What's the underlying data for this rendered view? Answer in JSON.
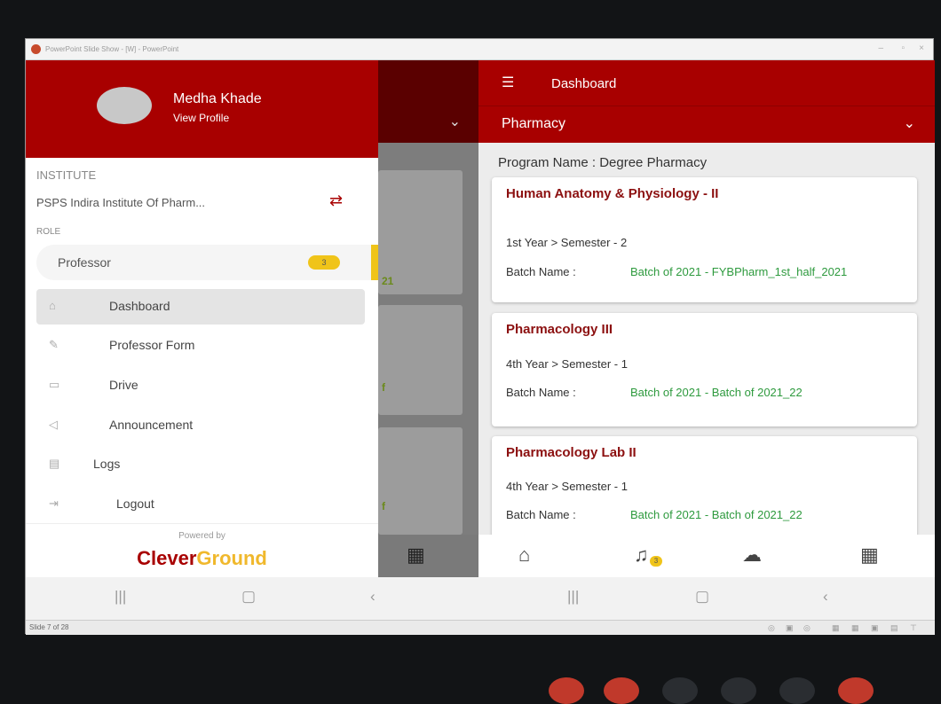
{
  "window": {
    "title": "PowerPoint Slide Show - [W] - PowerPoint",
    "controls": [
      "–",
      "▫",
      "×"
    ]
  },
  "drawer": {
    "user_name": "Medha Khade",
    "view_profile": "View Profile",
    "institute_heading": "INSTITUTE",
    "institute_name": "PSPS Indira Institute Of Pharm...",
    "role_heading": "ROLE",
    "role": "Professor",
    "role_badge": "3",
    "items": [
      {
        "label": "Dashboard",
        "icon": "home-icon"
      },
      {
        "label": "Professor Form",
        "icon": "form-icon"
      },
      {
        "label": "Drive",
        "icon": "folder-icon"
      },
      {
        "label": "Announcement",
        "icon": "megaphone-icon"
      },
      {
        "label": "Logs",
        "icon": "logs-icon"
      },
      {
        "label": "Logout",
        "icon": "logout-icon"
      }
    ],
    "powered_by": "Powered by",
    "brand_part1": "Clever",
    "brand_part2": "Ground"
  },
  "background_fragments": [
    "21",
    "f",
    "f"
  ],
  "header": {
    "title": "Dashboard",
    "department": "Pharmacy"
  },
  "program_name": "Program Name : Degree Pharmacy",
  "courses": [
    {
      "title": "Human Anatomy & Physiology - II",
      "year": "1st Year > Semester - 2",
      "batch_label": "Batch Name :",
      "batch_value": "Batch of 2021 - FYBPharm_1st_half_2021"
    },
    {
      "title": "Pharmacology III",
      "year": "4th Year > Semester - 1",
      "batch_label": "Batch Name :",
      "batch_value": "Batch of 2021 - Batch of 2021_22"
    },
    {
      "title": "Pharmacology Lab II",
      "year": "4th Year > Semester - 1",
      "batch_label": "Batch Name :",
      "batch_value": "Batch of 2021 - Batch of 2021_22"
    }
  ],
  "bottom_nav": {
    "notification_badge": "3"
  },
  "statusbar": {
    "slide": "Slide 7 of 28"
  },
  "colors": {
    "brand_red": "#a80000",
    "accent_yellow": "#f0c419",
    "batch_green": "#2e9a3e"
  }
}
